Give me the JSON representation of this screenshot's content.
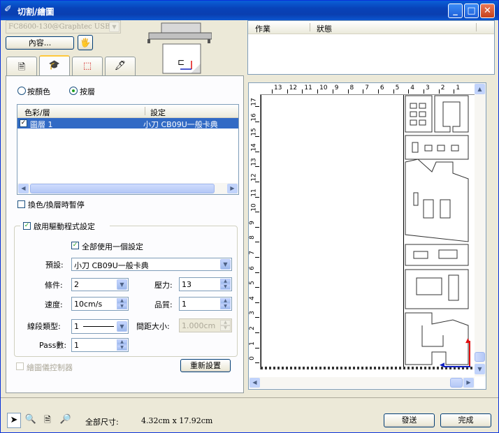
{
  "window": {
    "title": "切割/繪圖",
    "min_label": "_",
    "max_label": "□",
    "close_label": "✕"
  },
  "device": {
    "selected": "FC8600-130@Graphtec USB",
    "properties_label": "內容..."
  },
  "job_table": {
    "columns": [
      "作業",
      "狀態"
    ]
  },
  "tabs": [
    {
      "name": "tab-general",
      "icon": "page-icon"
    },
    {
      "name": "tab-cut",
      "icon": "cutter-icon",
      "active": true
    },
    {
      "name": "tab-layout",
      "icon": "frame-icon"
    },
    {
      "name": "tab-tool",
      "icon": "pen-tool-icon"
    }
  ],
  "mode": {
    "by_color": "按顏色",
    "by_layer": "按層",
    "selected": "by_layer"
  },
  "layer_list": {
    "col_layer": "色彩/層",
    "col_setting": "設定",
    "rows": [
      {
        "checked": true,
        "name": "圖層 1",
        "setting": "小刀 CB09U一般卡典"
      }
    ]
  },
  "pause_on_change": {
    "label": "換色/換層時暫停",
    "checked": false
  },
  "driver_settings": {
    "group_label": "啟用驅動程式設定",
    "enabled": true,
    "use_one_setting": {
      "label": "全部使用一個設定",
      "checked": true
    },
    "preset_label": "預設:",
    "preset_value": "小刀 CB09U一般卡典",
    "condition_label": "條件:",
    "condition_value": "2",
    "force_label": "壓力:",
    "force_value": "13",
    "speed_label": "速度:",
    "speed_value": "10cm/s",
    "quality_label": "品質:",
    "quality_value": "1",
    "linetype_label": "線段類型:",
    "linetype_value": "1",
    "spacing_label": "間距大小:",
    "spacing_value": "1.000cm",
    "pass_label": "Pass數:",
    "pass_value": "1",
    "reset_label": "重新設置"
  },
  "image_control": {
    "label": "繪圖儀控制器",
    "enabled": false
  },
  "preview": {
    "top_ruler": [
      "13",
      "12",
      "11",
      "10",
      "9",
      "8",
      "7",
      "6",
      "5",
      "4",
      "3",
      "2",
      "1"
    ],
    "left_ruler": [
      "17",
      "16",
      "15",
      "14",
      "13",
      "12",
      "11",
      "10",
      "9",
      "8",
      "7",
      "6",
      "5",
      "4",
      "3",
      "2",
      "1",
      "0"
    ]
  },
  "status_bar": {
    "size_label": "全部尺寸:",
    "size_value": "4.32cm x 17.92cm",
    "send_label": "發送",
    "done_label": "完成"
  },
  "colors": {
    "title_bar": "#0a4fc8",
    "dialog_bg": "#ece9d8",
    "selection": "#316ac5",
    "origin_red": "#e01010",
    "origin_blue": "#1020c0"
  }
}
